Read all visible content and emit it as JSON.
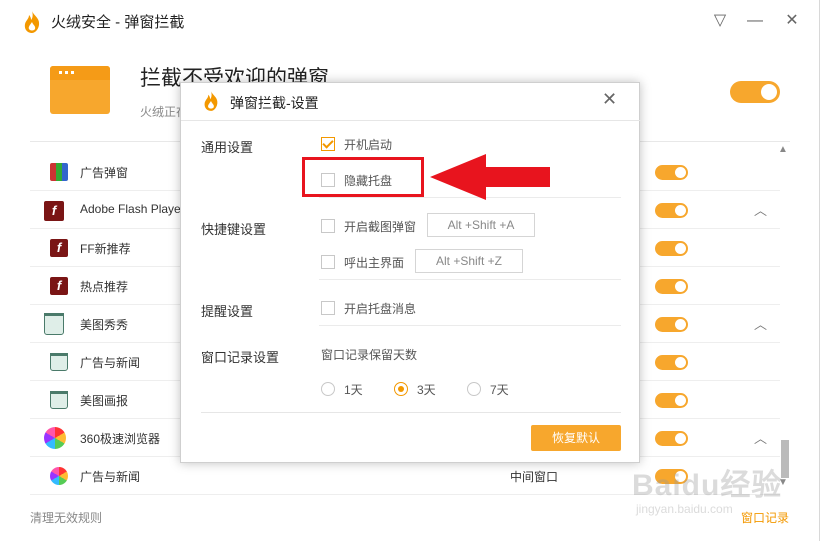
{
  "app": {
    "title": "火绒安全 - 弹窗拦截",
    "brand_color": "#f39800"
  },
  "window_controls": {
    "menu_icon": "triangle-menu-icon",
    "minimize_icon": "minimize-icon",
    "close_icon": "close-icon"
  },
  "header": {
    "title": "拦截不受欢迎的弹窗",
    "desc": "火绒正在",
    "enabled": true
  },
  "list": {
    "rows": [
      {
        "name": "广告弹窗",
        "type": "",
        "icon": "winrar-icon",
        "level": 2,
        "enabled": true,
        "expand": false
      },
      {
        "name": "Adobe Flash Player",
        "type": "",
        "icon": "flash-icon",
        "level": 1,
        "enabled": true,
        "expand": true
      },
      {
        "name": "FF新推荐",
        "type": "",
        "icon": "flash-icon",
        "level": 2,
        "enabled": true,
        "expand": false
      },
      {
        "name": "热点推荐",
        "type": "",
        "icon": "flash-icon",
        "level": 2,
        "enabled": true,
        "expand": false
      },
      {
        "name": "美图秀秀",
        "type": "",
        "icon": "trash-icon",
        "level": 1,
        "enabled": true,
        "expand": true
      },
      {
        "name": "广告与新闻",
        "type": "",
        "icon": "trash-icon",
        "level": 2,
        "enabled": true,
        "expand": false
      },
      {
        "name": "美图画报",
        "type": "",
        "icon": "trash-icon",
        "level": 2,
        "enabled": true,
        "expand": false
      },
      {
        "name": "360极速浏览器",
        "type": "",
        "icon": "browser-icon",
        "level": 1,
        "enabled": true,
        "expand": true
      },
      {
        "name": "广告与新闻",
        "type": "中间窗口",
        "icon": "browser-icon",
        "level": 2,
        "enabled": true,
        "expand": false
      }
    ]
  },
  "footer": {
    "clean_label": "清理无效规则",
    "log_label": "窗口记录"
  },
  "dialog": {
    "title": "弹窗拦截-设置",
    "sections": {
      "general": "通用设置",
      "hotkey": "快捷键设置",
      "reminder": "提醒设置",
      "log": "窗口记录设置"
    },
    "options": {
      "autostart": {
        "label": "开机启动",
        "checked": true
      },
      "hide_tray": {
        "label": "隐藏托盘",
        "checked": false
      },
      "screenshot_popup": {
        "label": "开启截图弹窗",
        "checked": false,
        "hotkey": "Alt +Shift +A"
      },
      "call_main": {
        "label": "呼出主界面",
        "checked": false,
        "hotkey": "Alt +Shift +Z"
      },
      "tray_message": {
        "label": "开启托盘消息",
        "checked": false
      }
    },
    "log_days": {
      "label": "窗口记录保留天数",
      "choices": [
        "1天",
        "3天",
        "7天"
      ],
      "selected": "3天"
    },
    "restore_label": "恢复默认",
    "annotation_color": "#e8141e"
  },
  "watermark": {
    "main": "Baidu经验",
    "sub": "jingyan.baidu.com"
  }
}
